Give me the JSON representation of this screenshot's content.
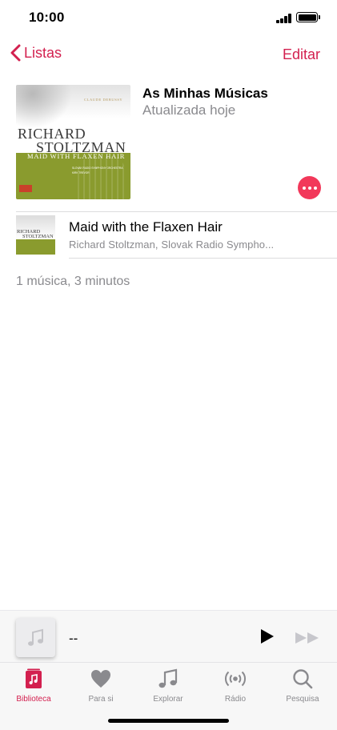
{
  "status_bar": {
    "time": "10:00"
  },
  "nav": {
    "back_label": "Listas",
    "edit_label": "Editar"
  },
  "playlist": {
    "title": "As Minhas Músicas",
    "subtitle": "Atualizada hoje",
    "artwork": {
      "composer": "CLAUDE DEBUSSY",
      "artist_line1": "RICHARD",
      "artist_line2": "STOLTZMAN",
      "album": "MAID WITH FLAXEN HAIR",
      "credits_line1": "SLOVAK RADIO SYMPHONY ORCHESTRA",
      "credits_line2": "KIRK TREVOR"
    },
    "summary": "1 música, 3 minutos"
  },
  "songs": [
    {
      "title": "Maid with the Flaxen Hair",
      "artist": "Richard Stoltzman, Slovak Radio Sympho..."
    }
  ],
  "mini_player": {
    "title": "--"
  },
  "tabs": [
    {
      "label": "Biblioteca",
      "icon": "library-icon",
      "active": true
    },
    {
      "label": "Para si",
      "icon": "heart-icon",
      "active": false
    },
    {
      "label": "Explorar",
      "icon": "music-note-icon",
      "active": false
    },
    {
      "label": "Rádio",
      "icon": "radio-icon",
      "active": false
    },
    {
      "label": "Pesquisa",
      "icon": "search-icon",
      "active": false
    }
  ],
  "colors": {
    "accent": "#d3204f",
    "more_button": "#f2385a",
    "secondary_text": "#8a8a8e"
  }
}
